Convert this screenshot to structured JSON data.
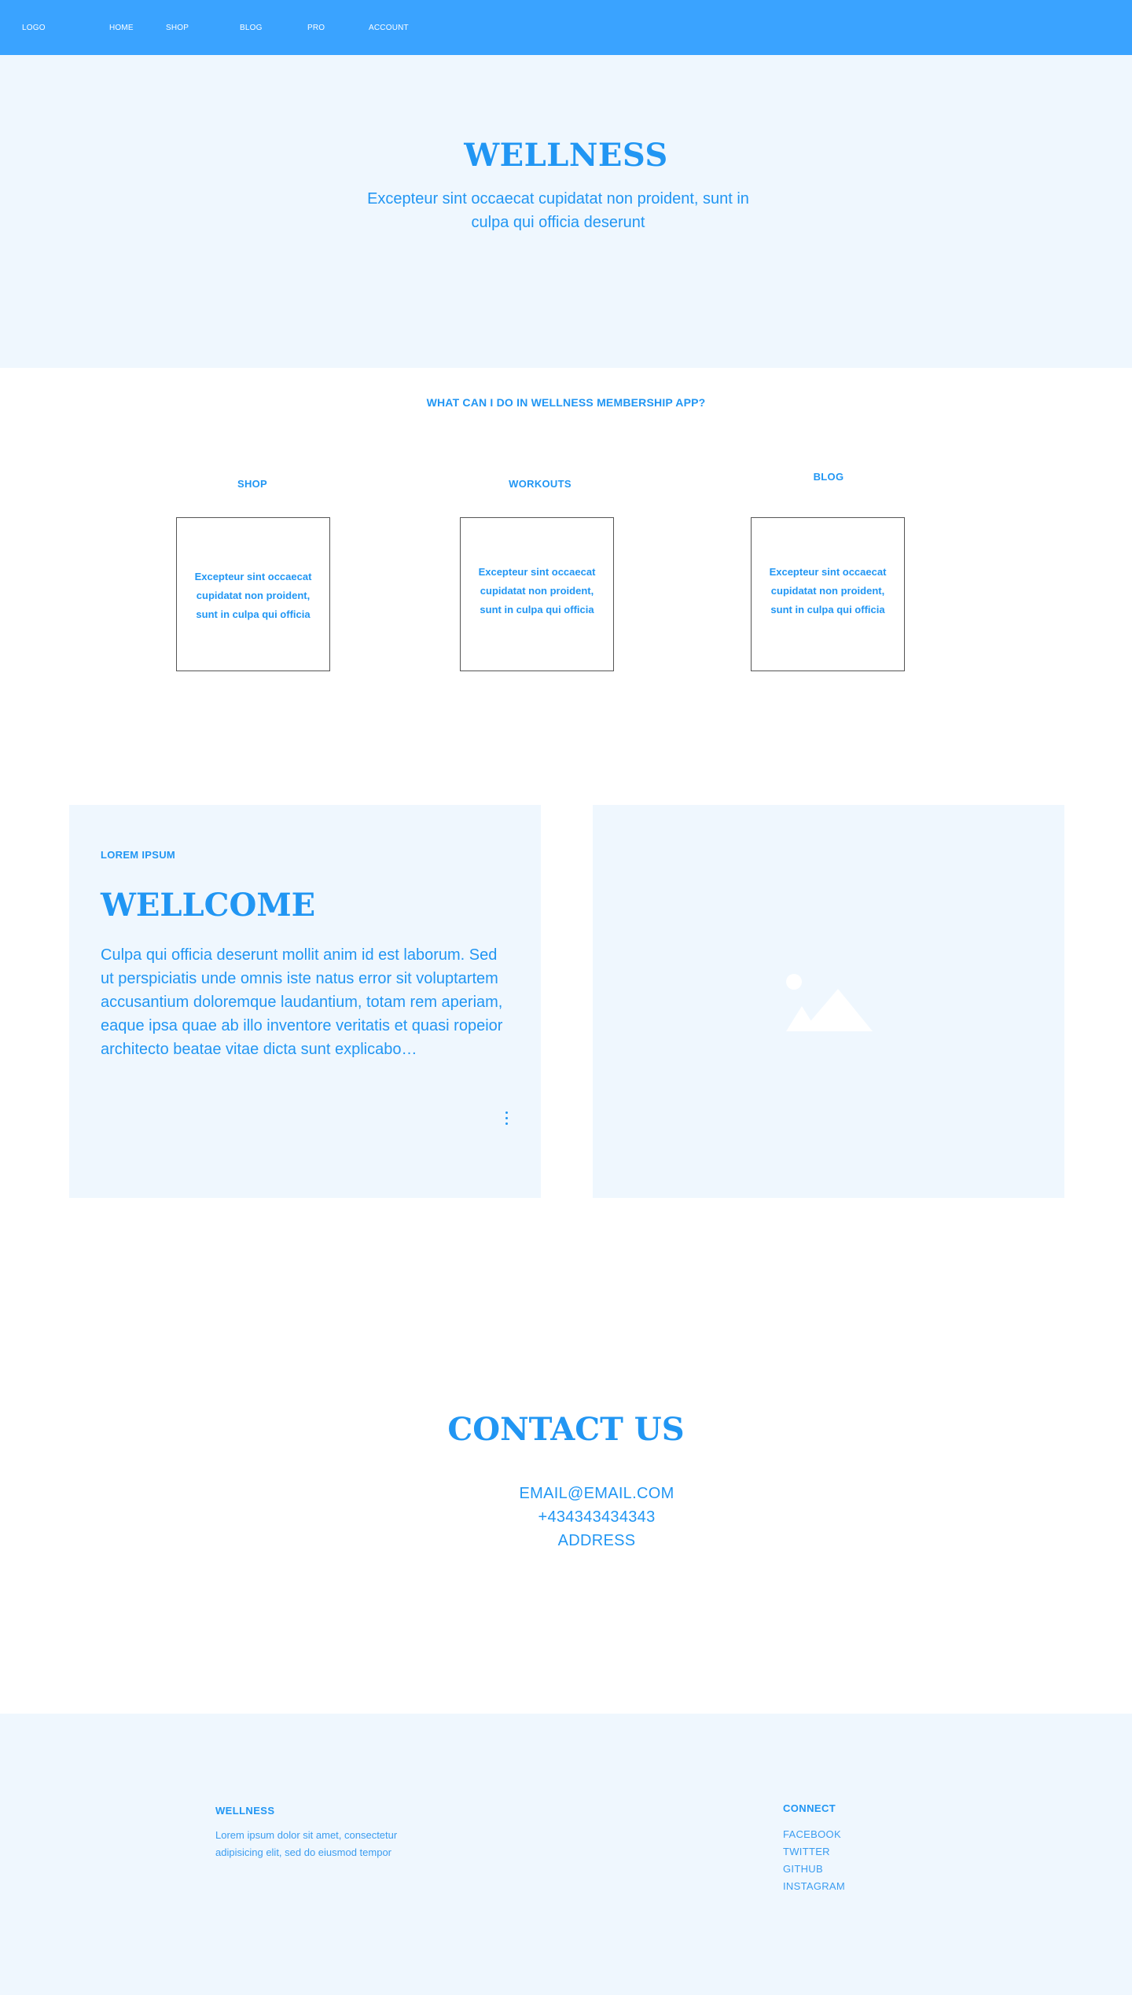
{
  "nav": {
    "logo": "LOGO",
    "items": [
      "HOME",
      "SHOP",
      "BLOG",
      "PRO",
      "ACCOUNT"
    ]
  },
  "hero": {
    "title": "WELLNESS",
    "subtitle": "Excepteur sint occaecat cupidatat non proident, sunt in culpa qui officia deserunt"
  },
  "features": {
    "heading": "WHAT CAN I DO IN WELLNESS MEMBERSHIP APP?",
    "items": [
      {
        "label": "SHOP",
        "text": "Excepteur sint occaecat cupidatat non proident, sunt in culpa qui officia"
      },
      {
        "label": "WORKOUTS",
        "text": "Excepteur sint occaecat cupidatat non proident, sunt in culpa qui officia"
      },
      {
        "label": "BLOG",
        "text": "Excepteur sint occaecat cupidatat non proident, sunt in culpa qui officia"
      }
    ]
  },
  "welcome": {
    "kicker": "LOREM IPSUM",
    "title": "WELLCOME",
    "text": "Culpa qui officia deserunt mollit anim id est laborum. Sed ut perspiciatis unde omnis iste natus error sit voluptartem accusantium doloremque laudantium, totam rem aperiam, eaque ipsa quae ab illo inventore veritatis et quasi ropeior architecto beatae vitae dicta sunt explicabo…",
    "more_icon": "more-vertical-icon",
    "image_icon": "image-placeholder-icon"
  },
  "contact": {
    "title": "CONTACT US",
    "email": "EMAIL@EMAIL.COM",
    "phone": "+434343434343",
    "address": "ADDRESS"
  },
  "footer": {
    "brand": "WELLNESS",
    "description": "Lorem ipsum dolor sit amet, consectetur adipisicing elit, sed do eiusmod tempor",
    "connect_title": "CONNECT",
    "links": [
      "FACEBOOK",
      "TWITTER",
      "GITHUB",
      "INSTAGRAM"
    ]
  },
  "colors": {
    "nav_bg": "#3aa3ff",
    "section_bg": "#eff7fe",
    "accent": "#2196f3"
  }
}
